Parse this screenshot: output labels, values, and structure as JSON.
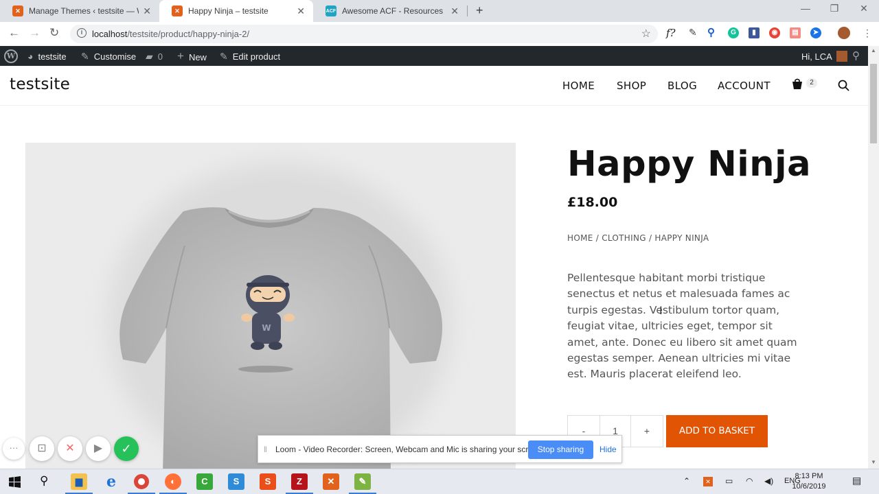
{
  "browser": {
    "tabs": [
      {
        "title": "Manage Themes ‹ testsite — Wo",
        "favicon": "xampp-icon",
        "color": "#e0621d"
      },
      {
        "title": "Happy Ninja – testsite",
        "favicon": "xampp-icon",
        "color": "#e0621d"
      },
      {
        "title": "Awesome ACF - Resources for Ac",
        "favicon": "acf-icon",
        "color": "#21a4c4"
      }
    ],
    "new_tab": "+",
    "url_host": "localhost",
    "url_path": "/testsite/product/happy-ninja-2/"
  },
  "adminbar": {
    "site": "testsite",
    "customise": "Customise",
    "comments": "0",
    "new": "New",
    "edit": "Edit product",
    "greeting": "Hi, LCA"
  },
  "site": {
    "title": "testsite",
    "nav": [
      "HOME",
      "SHOP",
      "BLOG",
      "ACCOUNT"
    ],
    "cart_count": "2"
  },
  "product": {
    "title": "Happy Ninja",
    "price": "£18.00",
    "breadcrumb": [
      "Home",
      "Clothing",
      "Happy Ninja"
    ],
    "description": "Pellentesque habitant morbi tristique senectus et netus et malesuada fames ac turpis egestas. Vestibulum tortor quam, feugiat vitae, ultricies eget, tempor sit amet, ante. Donec eu libero sit amet quam egestas semper. Aenean ultricies mi vitae est. Mauris placerat eleifend leo.",
    "qty_minus": "-",
    "qty": "1",
    "qty_plus": "+",
    "add_to_basket": "ADD TO BASKET",
    "accent_color": "#e15404"
  },
  "loom": {
    "message": "Loom - Video Recorder: Screen, Webcam and Mic is sharing your screen.",
    "stop": "Stop sharing",
    "hide": "Hide"
  },
  "taskbar": {
    "lang": "ENG",
    "time": "8:13 PM",
    "date": "10/6/2019"
  }
}
